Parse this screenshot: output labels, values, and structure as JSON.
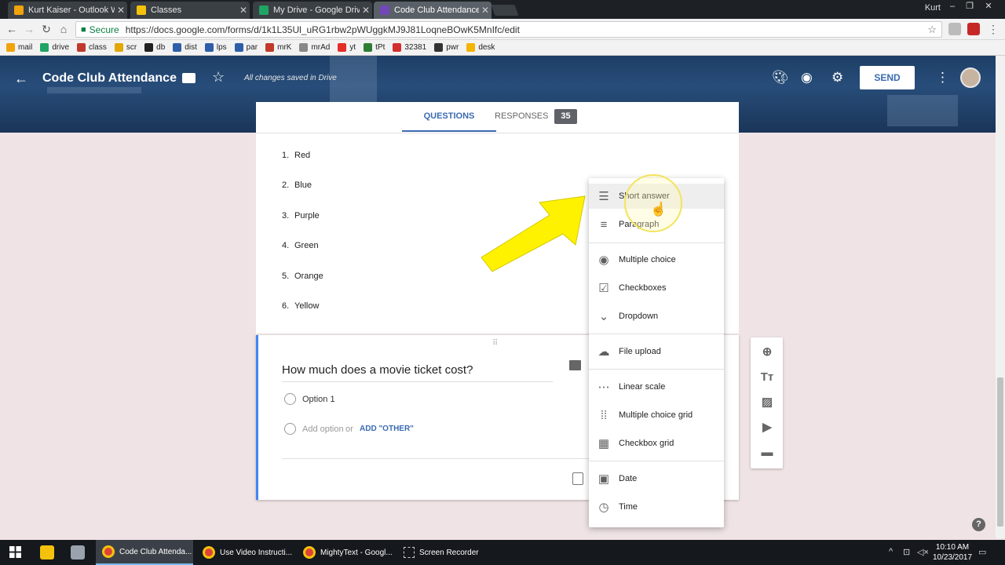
{
  "browser": {
    "tabs": [
      {
        "title": "Kurt Kaiser - Outlook We",
        "favicon_color": "#f0a30a"
      },
      {
        "title": "Classes",
        "favicon_color": "#f4c20d"
      },
      {
        "title": "My Drive - Google Drive",
        "favicon_color": "#1fa463"
      },
      {
        "title": "Code Club Attendance -",
        "favicon_color": "#7248b9"
      }
    ],
    "user": "Kurt",
    "secure_label": "Secure",
    "url": "https://docs.google.com/forms/d/1k1L35Ul_uRG1rbw2pWUggkMJ9J81LoqneBOwK5MnIfc/edit",
    "bookmarks": [
      {
        "label": "mail",
        "color": "#f0a30a"
      },
      {
        "label": "drive",
        "color": "#1fa463"
      },
      {
        "label": "class",
        "color": "#c0392b"
      },
      {
        "label": "scr",
        "color": "#e0a800"
      },
      {
        "label": "db",
        "color": "#222222"
      },
      {
        "label": "dist",
        "color": "#2d5ea8"
      },
      {
        "label": "lps",
        "color": "#2d5ea8"
      },
      {
        "label": "par",
        "color": "#2d5ea8"
      },
      {
        "label": "mrK",
        "color": "#c0392b"
      },
      {
        "label": "mrAd",
        "color": "#888888"
      },
      {
        "label": "yt",
        "color": "#e52d27"
      },
      {
        "label": "tPt",
        "color": "#2e7d32"
      },
      {
        "label": "32381",
        "color": "#d32f2f"
      },
      {
        "label": "pwr",
        "color": "#333333"
      },
      {
        "label": "desk",
        "color": "#f4b400"
      }
    ]
  },
  "form_header": {
    "title": "Code Club Attendance",
    "saved_status": "All changes saved in Drive",
    "send_label": "SEND"
  },
  "tabs": {
    "questions": "QUESTIONS",
    "responses": "RESPONSES",
    "responses_count": "35"
  },
  "previous_question": {
    "items": [
      {
        "num": "1.",
        "label": "Red"
      },
      {
        "num": "2.",
        "label": "Blue"
      },
      {
        "num": "3.",
        "label": "Purple"
      },
      {
        "num": "4.",
        "label": "Green"
      },
      {
        "num": "5.",
        "label": "Orange"
      },
      {
        "num": "6.",
        "label": "Yellow"
      }
    ]
  },
  "active_question": {
    "title": "How much does a movie ticket cost?",
    "option1": "Option 1",
    "add_option": "Add option",
    "or": "or",
    "add_other": "ADD \"OTHER\""
  },
  "type_menu": {
    "items": [
      {
        "label": "Short answer",
        "icon": "short-answer-icon",
        "glyph": "☰"
      },
      {
        "label": "Paragraph",
        "icon": "paragraph-icon",
        "glyph": "≡"
      },
      {
        "label": "Multiple choice",
        "icon": "radio-icon",
        "glyph": "◉"
      },
      {
        "label": "Checkboxes",
        "icon": "checkbox-icon",
        "glyph": "☑"
      },
      {
        "label": "Dropdown",
        "icon": "dropdown-icon",
        "glyph": "⌄"
      },
      {
        "label": "File upload",
        "icon": "cloud-upload-icon",
        "glyph": "☁"
      },
      {
        "label": "Linear scale",
        "icon": "linear-scale-icon",
        "glyph": "⋯"
      },
      {
        "label": "Multiple choice grid",
        "icon": "grid-icon",
        "glyph": "⁞⁞"
      },
      {
        "label": "Checkbox grid",
        "icon": "checkbox-grid-icon",
        "glyph": "▦"
      },
      {
        "label": "Date",
        "icon": "calendar-icon",
        "glyph": "▣"
      },
      {
        "label": "Time",
        "icon": "clock-icon",
        "glyph": "◷"
      }
    ]
  },
  "taskbar": {
    "items": [
      {
        "label": "Code Club Attenda..."
      },
      {
        "label": "Use Video Instructi..."
      },
      {
        "label": "MightyText - Googl..."
      },
      {
        "label": "Screen Recorder"
      }
    ],
    "time": "10:10 AM",
    "date": "10/23/2017"
  },
  "colors": {
    "accent": "#3a6bb0",
    "active_border": "#4285f4",
    "arrow": "#fff200"
  }
}
